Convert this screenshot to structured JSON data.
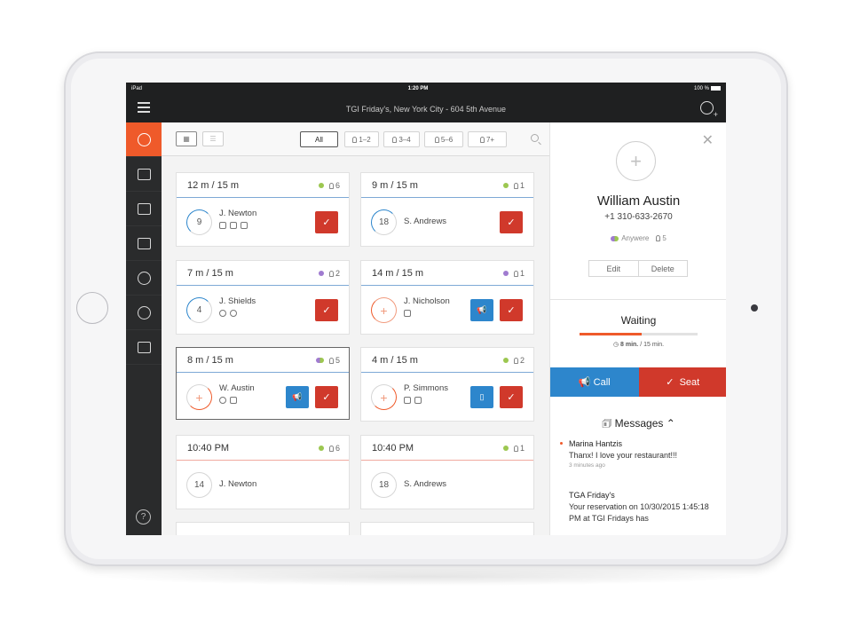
{
  "status_bar": {
    "device": "iPad",
    "time": "1:20 PM",
    "battery": "100 %"
  },
  "top_bar": {
    "title": "TGI Friday's, New York City - 604 5th Avenue"
  },
  "sidebar": {
    "items": [
      {
        "icon": "clock-icon",
        "active": true
      },
      {
        "icon": "table-icon"
      },
      {
        "icon": "layout-icon"
      },
      {
        "icon": "calendar-icon"
      },
      {
        "icon": "guest-icon"
      },
      {
        "icon": "trophy-icon"
      },
      {
        "icon": "contacts-icon"
      }
    ],
    "help": "?"
  },
  "toolbar": {
    "filters": [
      "All",
      "1–2",
      "3–4",
      "5–6",
      "7+"
    ]
  },
  "cards": [
    {
      "time": "12 m / 15 m",
      "party": "6",
      "dot": "green",
      "badge": "9",
      "ring": "blue",
      "name": "J. Newton",
      "actions": [
        "seat"
      ]
    },
    {
      "time": "9 m / 15 m",
      "party": "1",
      "dot": "green",
      "badge": "18",
      "ring": "blue",
      "name": "S. Andrews",
      "actions": [
        "seat"
      ]
    },
    {
      "time": "7 m / 15 m",
      "party": "2",
      "dot": "purple",
      "badge": "4",
      "ring": "blue",
      "name": "J. Shields",
      "actions": [
        "seat"
      ]
    },
    {
      "time": "14 m / 15 m",
      "party": "1",
      "dot": "purple",
      "badge": "+",
      "ring": "orange-full",
      "name": "J. Nicholson",
      "actions": [
        "call",
        "seat"
      ]
    },
    {
      "time": "8 m / 15 m",
      "party": "5",
      "dot": "mix",
      "badge": "+",
      "ring": "orange",
      "name": "W. Austin",
      "actions": [
        "call",
        "seat"
      ],
      "selected": true
    },
    {
      "time": "4 m / 15 m",
      "party": "2",
      "dot": "green",
      "badge": "+",
      "ring": "orange",
      "name": "P. Simmons",
      "actions": [
        "phone",
        "seat"
      ]
    },
    {
      "time": "10:40 PM",
      "party": "6",
      "dot": "green",
      "badge": "14",
      "ring": "plain",
      "name": "J. Newton",
      "actions": []
    },
    {
      "time": "10:40 PM",
      "party": "1",
      "dot": "green",
      "badge": "18",
      "ring": "plain",
      "name": "S. Andrews",
      "actions": []
    }
  ],
  "panel": {
    "avatar_plus": "+",
    "guest_name": "William Austin",
    "guest_phone": "+1 310-633-2670",
    "source": "Anywere",
    "party": "5",
    "edit": "Edit",
    "delete": "Delete",
    "waiting_label": "Waiting",
    "wait_time_bold": "8 min.",
    "wait_time_rest": " / 15 min.",
    "wait_progress": 0.53,
    "call": "Call",
    "seat": "Seat",
    "messages_label": "Messages",
    "messages": [
      {
        "from": "Marina Hantzis",
        "text": "Thanx! I love your restaurant!!!",
        "when": "3 minutes ago"
      },
      {
        "from": "TGA Friday's",
        "text": "Your reservation on 10/30/2015 1:45:18 PM at TGI Fridays has",
        "when": ""
      }
    ]
  },
  "colors": {
    "accent": "#ef5a2a",
    "blue": "#2d86cc",
    "red": "#d0392b",
    "dark": "#1f2021"
  }
}
